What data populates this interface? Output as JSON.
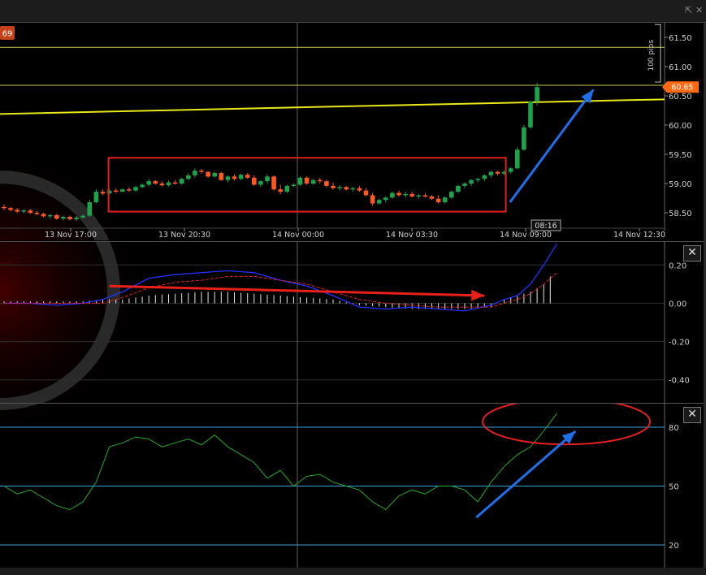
{
  "window": {
    "icons": [
      "popout-icon",
      "close-icon"
    ]
  },
  "price_panel": {
    "badge_left": "69",
    "current_price": "60.65",
    "pips_label": "100 pips",
    "crosshair_time": "08:16",
    "colors": {
      "bull": "#1fa34a",
      "bear": "#ff5722",
      "trendline": "#e8e81a",
      "hline": "#c9c94a",
      "annotation_box": "#e02020",
      "arrow": "#1e6fe8",
      "price_tag": "#ff6a13"
    }
  },
  "macd_panel": {
    "colors": {
      "macd": "#2233ff",
      "signal": "#e02020",
      "hist": "#ffffff",
      "arrow": "#e8201a"
    }
  },
  "rsi_panel": {
    "colors": {
      "rsi": "#22aa22",
      "levels": "#3aa0d8",
      "ellipse": "#e02020",
      "arrow": "#1e6fe8"
    }
  },
  "chart_data": [
    {
      "type": "candlestick",
      "x_ticks": [
        "13 Nov 17:00",
        "13 Nov 20:30",
        "14 Nov 00:00",
        "14 Nov 03:30",
        "14 Nov 09:00",
        "14 Nov 12:30"
      ],
      "y_ticks": [
        "58.50",
        "59.00",
        "59.50",
        "60.00",
        "60.50",
        "61.00",
        "61.50"
      ],
      "ylim": [
        58.25,
        61.75
      ],
      "candles": [
        [
          58.6,
          58.64,
          58.55,
          58.58
        ],
        [
          58.58,
          58.6,
          58.52,
          58.55
        ],
        [
          58.55,
          58.58,
          58.5,
          58.52
        ],
        [
          58.52,
          58.56,
          58.49,
          58.54
        ],
        [
          58.54,
          58.56,
          58.48,
          58.5
        ],
        [
          58.5,
          58.53,
          58.46,
          58.48
        ],
        [
          58.48,
          58.5,
          58.42,
          58.44
        ],
        [
          58.44,
          58.48,
          58.4,
          58.46
        ],
        [
          58.46,
          58.48,
          58.38,
          58.4
        ],
        [
          58.4,
          58.45,
          58.37,
          58.43
        ],
        [
          58.43,
          58.45,
          58.37,
          58.39
        ],
        [
          58.39,
          58.44,
          58.36,
          58.42
        ],
        [
          58.42,
          58.47,
          58.4,
          58.45
        ],
        [
          58.45,
          58.72,
          58.43,
          58.68
        ],
        [
          58.68,
          58.9,
          58.66,
          58.86
        ],
        [
          58.86,
          58.9,
          58.8,
          58.83
        ],
        [
          58.83,
          58.9,
          58.81,
          58.88
        ],
        [
          58.88,
          58.92,
          58.84,
          58.86
        ],
        [
          58.86,
          58.92,
          58.85,
          58.9
        ],
        [
          58.9,
          58.94,
          58.86,
          58.88
        ],
        [
          58.88,
          58.96,
          58.86,
          58.94
        ],
        [
          58.94,
          59.0,
          58.92,
          58.98
        ],
        [
          58.98,
          59.08,
          58.95,
          59.04
        ],
        [
          59.04,
          59.06,
          58.98,
          59.0
        ],
        [
          59.0,
          59.04,
          58.95,
          58.97
        ],
        [
          58.97,
          59.05,
          58.95,
          59.02
        ],
        [
          59.02,
          59.06,
          58.98,
          59.0
        ],
        [
          59.0,
          59.1,
          58.98,
          59.08
        ],
        [
          59.08,
          59.18,
          59.05,
          59.14
        ],
        [
          59.14,
          59.26,
          59.1,
          59.22
        ],
        [
          59.22,
          59.25,
          59.17,
          59.2
        ],
        [
          59.2,
          59.21,
          59.1,
          59.12
        ],
        [
          59.12,
          59.2,
          59.1,
          59.18
        ],
        [
          59.18,
          59.2,
          59.05,
          59.06
        ],
        [
          59.06,
          59.14,
          59.02,
          59.12
        ],
        [
          59.12,
          59.16,
          59.05,
          59.08
        ],
        [
          59.08,
          59.17,
          59.06,
          59.15
        ],
        [
          59.15,
          59.18,
          59.08,
          59.1
        ],
        [
          59.1,
          59.14,
          58.96,
          58.98
        ],
        [
          58.98,
          59.06,
          58.94,
          59.04
        ],
        [
          59.04,
          59.16,
          59.0,
          59.12
        ],
        [
          59.12,
          59.14,
          58.88,
          58.9
        ],
        [
          58.9,
          58.98,
          58.82,
          58.86
        ],
        [
          58.86,
          58.98,
          58.84,
          58.96
        ],
        [
          58.96,
          59.0,
          58.94,
          58.98
        ],
        [
          58.98,
          59.12,
          58.96,
          59.1
        ],
        [
          59.1,
          59.12,
          58.98,
          59.0
        ],
        [
          59.0,
          59.08,
          58.98,
          59.06
        ],
        [
          59.06,
          59.1,
          59.0,
          59.04
        ],
        [
          59.04,
          59.06,
          58.94,
          58.96
        ],
        [
          58.96,
          59.02,
          58.9,
          58.92
        ],
        [
          58.92,
          58.97,
          58.88,
          58.94
        ],
        [
          58.94,
          58.96,
          58.88,
          58.9
        ],
        [
          58.9,
          58.94,
          58.86,
          58.92
        ],
        [
          58.92,
          58.96,
          58.86,
          58.88
        ],
        [
          58.88,
          58.92,
          58.78,
          58.8
        ],
        [
          58.8,
          58.84,
          58.62,
          58.66
        ],
        [
          58.66,
          58.74,
          58.64,
          58.72
        ],
        [
          58.72,
          58.78,
          58.68,
          58.76
        ],
        [
          58.76,
          58.86,
          58.74,
          58.84
        ],
        [
          58.84,
          58.88,
          58.78,
          58.8
        ],
        [
          58.8,
          58.86,
          58.76,
          58.82
        ],
        [
          58.82,
          58.86,
          58.76,
          58.78
        ],
        [
          58.78,
          58.82,
          58.74,
          58.8
        ],
        [
          58.8,
          58.84,
          58.76,
          58.78
        ],
        [
          58.78,
          58.8,
          58.72,
          58.74
        ],
        [
          58.74,
          58.8,
          58.66,
          58.68
        ],
        [
          58.68,
          58.78,
          58.66,
          58.76
        ],
        [
          58.76,
          58.88,
          58.74,
          58.86
        ],
        [
          58.86,
          58.98,
          58.84,
          58.96
        ],
        [
          58.96,
          59.02,
          58.92,
          59.0
        ],
        [
          59.0,
          59.08,
          58.96,
          59.06
        ],
        [
          59.06,
          59.1,
          59.02,
          59.08
        ],
        [
          59.08,
          59.16,
          59.04,
          59.14
        ],
        [
          59.14,
          59.22,
          59.1,
          59.2
        ],
        [
          59.2,
          59.22,
          59.14,
          59.17
        ],
        [
          59.17,
          59.22,
          59.14,
          59.2
        ],
        [
          59.2,
          59.28,
          59.17,
          59.26
        ],
        [
          59.26,
          59.62,
          59.24,
          59.58
        ],
        [
          59.58,
          60.0,
          59.56,
          59.96
        ],
        [
          59.96,
          60.42,
          59.94,
          60.4
        ],
        [
          60.4,
          60.72,
          60.34,
          60.65
        ]
      ],
      "hlines": [
        61.33,
        60.68
      ],
      "trendline": {
        "x_from": 0,
        "x_to": 83,
        "y_from": 60.19,
        "y_to": 60.44
      },
      "annotations": [
        {
          "type": "rect",
          "x_from": 16,
          "x_to": 76,
          "y_from": 58.52,
          "y_to": 59.44
        },
        {
          "type": "arrow",
          "x_from": 77,
          "x_to": 84,
          "y_from": 58.68,
          "y_to": 60.55
        }
      ]
    },
    {
      "type": "line",
      "name": "macd",
      "y_ticks": [
        "-0.40",
        "-0.20",
        "0.00",
        "0.20"
      ],
      "ylim": [
        -0.52,
        0.32
      ],
      "x": [
        0,
        4,
        8,
        12,
        15,
        18,
        22,
        26,
        30,
        34,
        38,
        42,
        46,
        50,
        54,
        58,
        62,
        66,
        70,
        74,
        76,
        78,
        80,
        82,
        84
      ],
      "macd": [
        0.0,
        0.0,
        -0.01,
        0.0,
        0.02,
        0.06,
        0.13,
        0.15,
        0.16,
        0.17,
        0.16,
        0.12,
        0.09,
        0.04,
        -0.02,
        -0.03,
        -0.02,
        -0.03,
        -0.04,
        -0.01,
        0.02,
        0.04,
        0.1,
        0.2,
        0.31
      ],
      "signal": [
        0.0,
        0.0,
        0.0,
        0.0,
        0.0,
        0.03,
        0.08,
        0.11,
        0.12,
        0.14,
        0.14,
        0.12,
        0.1,
        0.06,
        0.02,
        0.0,
        -0.01,
        -0.02,
        -0.02,
        -0.02,
        0.0,
        0.02,
        0.05,
        0.1,
        0.16
      ],
      "histogram": [
        0.01,
        0.01,
        0.01,
        0.01,
        0.02,
        0.02,
        0.04,
        0.05,
        0.06,
        0.06,
        0.05,
        0.04,
        0.03,
        0.02,
        -0.01,
        -0.02,
        -0.03,
        -0.03,
        -0.03,
        -0.02,
        0.02,
        0.04,
        0.06,
        0.1,
        0.18
      ],
      "annotations": [
        {
          "type": "arrow",
          "x_from": 16,
          "x_to": 73,
          "y_from": 0.09,
          "y_to": 0.04
        }
      ]
    },
    {
      "type": "line",
      "name": "rsi",
      "y_ticks": [
        "20",
        "50",
        "80"
      ],
      "ylim": [
        8,
        92
      ],
      "levels": [
        20,
        50,
        80
      ],
      "x": [
        0,
        2,
        4,
        6,
        8,
        10,
        12,
        14,
        16,
        18,
        20,
        22,
        24,
        26,
        28,
        30,
        32,
        34,
        36,
        38,
        40,
        42,
        44,
        46,
        48,
        50,
        52,
        54,
        56,
        58,
        60,
        62,
        64,
        66,
        68,
        70,
        72,
        74,
        76,
        78,
        80,
        82,
        84
      ],
      "values": [
        50,
        46,
        48,
        44,
        40,
        38,
        42,
        52,
        70,
        72,
        75,
        74,
        70,
        72,
        74,
        71,
        76,
        70,
        66,
        62,
        54,
        58,
        50,
        55,
        56,
        52,
        50,
        48,
        42,
        38,
        45,
        48,
        46,
        50,
        50,
        48,
        42,
        52,
        60,
        66,
        70,
        78,
        87
      ],
      "annotations": [
        {
          "type": "ellipse",
          "x_center": 81,
          "y_center": 82,
          "x_radius": 10,
          "y_radius": 12
        },
        {
          "type": "arrow",
          "x_from": 72,
          "x_to": 83,
          "y_from": 34,
          "y_to": 80
        }
      ]
    }
  ]
}
